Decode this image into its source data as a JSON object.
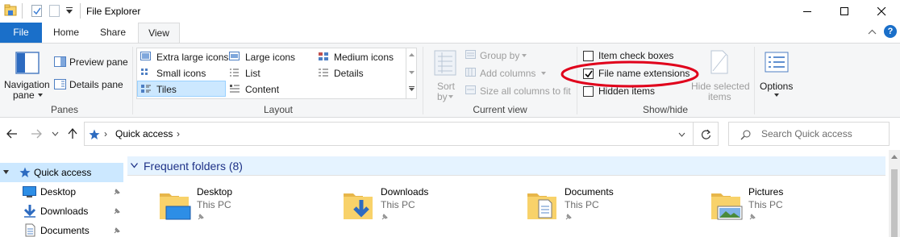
{
  "titlebar": {
    "title": "File Explorer",
    "controls": [
      "minimize",
      "maximize",
      "close"
    ]
  },
  "tabs": [
    {
      "label": "File",
      "active": false
    },
    {
      "label": "Home",
      "active": false
    },
    {
      "label": "Share",
      "active": false
    },
    {
      "label": "View",
      "active": true
    }
  ],
  "ribbon": {
    "panes": {
      "navigation_pane": "Navigation",
      "navigation_pane_line2": "pane",
      "preview_pane": "Preview pane",
      "details_pane": "Details pane",
      "group_label": "Panes"
    },
    "layout": {
      "items": [
        "Extra large icons",
        "Large icons",
        "Medium icons",
        "Small icons",
        "List",
        "Details",
        "Tiles",
        "Content"
      ],
      "selected": "Tiles",
      "group_label": "Layout"
    },
    "current_view": {
      "sort_by": "Sort",
      "sort_by_line2": "by",
      "group_by": "Group by",
      "add_columns": "Add columns",
      "size_all_columns": "Size all columns to fit",
      "group_label": "Current view"
    },
    "show_hide": {
      "item_check_boxes": "Item check boxes",
      "item_check_boxes_checked": false,
      "file_name_extensions": "File name extensions",
      "file_name_extensions_checked": true,
      "hidden_items": "Hidden items",
      "hidden_items_checked": false,
      "hide_selected": "Hide selected",
      "hide_selected_line2": "items",
      "group_label": "Show/hide"
    },
    "options": "Options",
    "annotation_color": "#e0001b"
  },
  "address": {
    "path": "Quick access",
    "search_placeholder": "Search Quick access"
  },
  "navpane": {
    "items": [
      {
        "label": "Quick access",
        "selected": true
      },
      {
        "label": "Desktop",
        "pinned": true
      },
      {
        "label": "Downloads",
        "pinned": true
      },
      {
        "label": "Documents",
        "pinned": true
      }
    ]
  },
  "content": {
    "group_title": "Frequent folders (8)",
    "folders": [
      {
        "name": "Desktop",
        "location": "This PC"
      },
      {
        "name": "Downloads",
        "location": "This PC"
      },
      {
        "name": "Documents",
        "location": "This PC"
      },
      {
        "name": "Pictures",
        "location": "This PC"
      }
    ]
  },
  "colors": {
    "accent": "#1a6fc9",
    "selection": "#cce8ff",
    "group_header": "#e5f3ff",
    "group_title": "#1e3287"
  }
}
